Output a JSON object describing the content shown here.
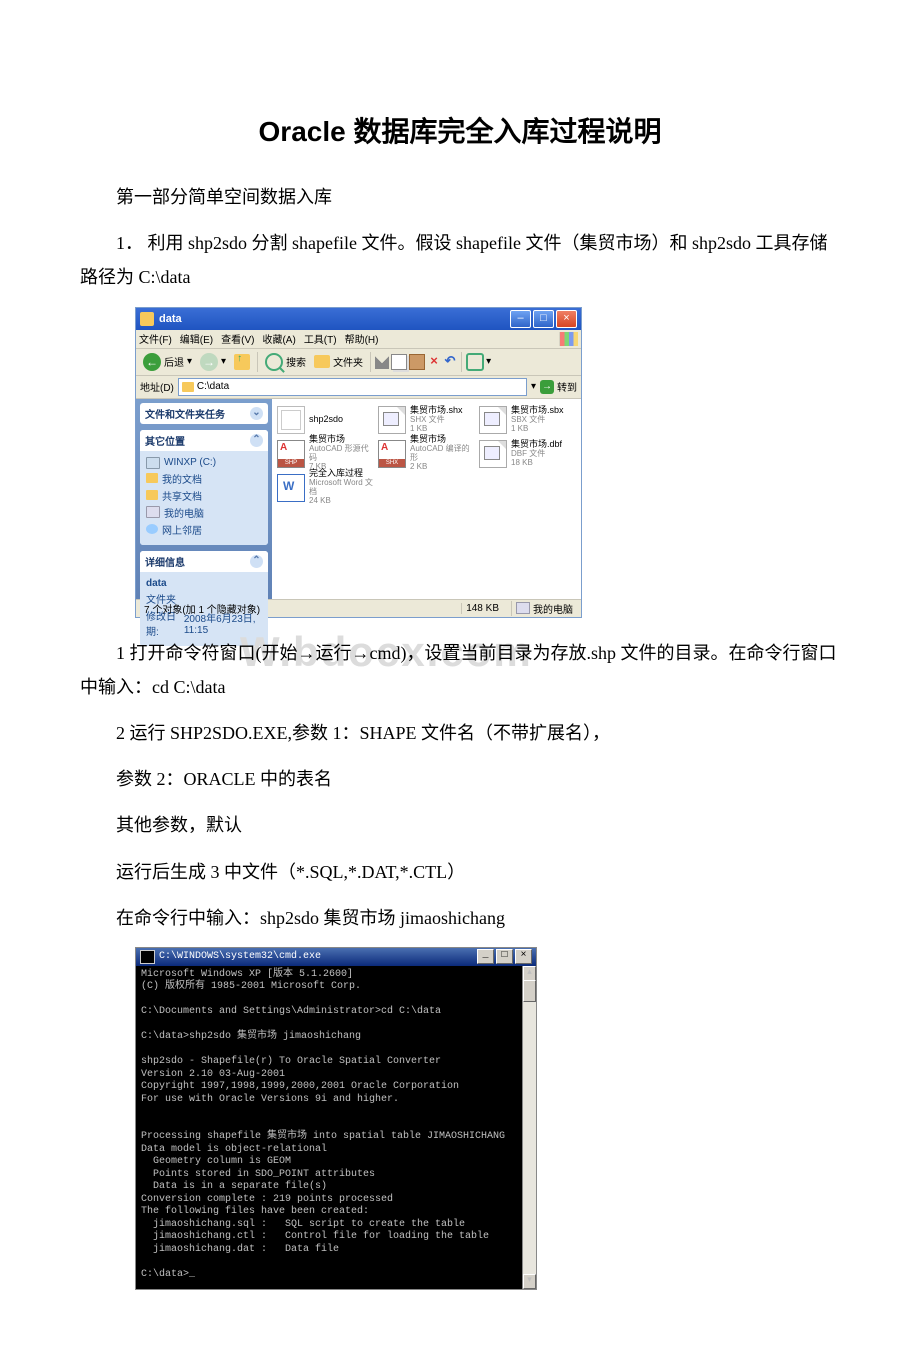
{
  "title": "Oracle 数据库完全入库过程说明",
  "p1": "第一部分简单空间数据入库",
  "p2": "1． 利用 shp2sdo 分割 shapefile 文件。假设 shapefile 文件（集贸市场）和 shp2sdo 工具存储路径为 C:\\data",
  "explorer": {
    "title": "data",
    "menu": {
      "file": "文件(F)",
      "edit": "编辑(E)",
      "view": "查看(V)",
      "fav": "收藏(A)",
      "tools": "工具(T)",
      "help": "帮助(H)"
    },
    "toolbar": {
      "back": "后退",
      "search": "搜索",
      "folders": "文件夹"
    },
    "address_label": "地址(D)",
    "address_value": "C:\\data",
    "go": "转到",
    "side": {
      "tasks_title": "文件和文件夹任务",
      "other_title": "其它位置",
      "other_items": [
        "WINXP (C:)",
        "我的文档",
        "共享文档",
        "我的电脑",
        "网上邻居"
      ],
      "details_title": "详细信息",
      "details_name": "data",
      "details_type": "文件夹",
      "details_mod_lbl": "修改日期:",
      "details_mod_val": "2008年6月23日, 11:15"
    },
    "files": [
      {
        "icon": "exe",
        "t1": "shp2sdo",
        "t2": ""
      },
      {
        "icon": "gen",
        "t1": "集贸市场.shx",
        "t2": "SHX 文件",
        "t3": "1 KB"
      },
      {
        "icon": "gen",
        "t1": "集贸市场.sbx",
        "t2": "SBX 文件",
        "t3": "1 KB"
      },
      {
        "icon": "shp",
        "t1": "集贸市场",
        "t2": "AutoCAD 形源代码",
        "t3": "7 KB",
        "lbl": "SHP"
      },
      {
        "icon": "shp",
        "t1": "集贸市场",
        "t2": "AutoCAD 编译的形",
        "t3": "2 KB",
        "lbl": "SHX"
      },
      {
        "icon": "gen",
        "t1": "集贸市场.dbf",
        "t2": "DBF 文件",
        "t3": "18 KB"
      },
      {
        "icon": "doc",
        "t1": "完全入库过程",
        "t2": "Microsoft Word 文档",
        "t3": "24 KB"
      }
    ],
    "status_left": "7 个对象(加 1 个隐藏对象)",
    "status_mid": "148 KB",
    "status_right": "我的电脑"
  },
  "p3": "1 打开命令符窗口(开始→运行→cmd)，设置当前目录为存放.shp 文件的目录。在命令行窗口中输入：cd C:\\data",
  "p4": "2 运行 SHP2SDO.EXE,参数 1：SHAPE 文件名（不带扩展名），",
  "p5": " 参数 2：ORACLE 中的表名",
  "p6": " 其他参数，默认",
  "p7": " 运行后生成 3 中文件（*.SQL,*.DAT,*.CTL）",
  "p8": " 在命令行中输入：shp2sdo 集贸市场 jimaoshichang",
  "watermark": "W.bdocx.com",
  "cmd": {
    "title": "C:\\WINDOWS\\system32\\cmd.exe",
    "lines": "Microsoft Windows XP [版本 5.1.2600]\n(C) 版权所有 1985-2001 Microsoft Corp.\n\nC:\\Documents and Settings\\Administrator>cd C:\\data\n\nC:\\data>shp2sdo 集贸市场 jimaoshichang\n\nshp2sdo - Shapefile(r) To Oracle Spatial Converter\nVersion 2.10 03-Aug-2001\nCopyright 1997,1998,1999,2000,2001 Oracle Corporation\nFor use with Oracle Versions 9i and higher.\n\n\nProcessing shapefile 集贸市场 into spatial table JIMAOSHICHANG\nData model is object-relational\n  Geometry column is GEOM\n  Points stored in SDO_POINT attributes\n  Data is in a separate file(s)\nConversion complete : 219 points processed\nThe following files have been created:\n  jimaoshichang.sql :   SQL script to create the table\n  jimaoshichang.ctl :   Control file for loading the table\n  jimaoshichang.dat :   Data file\n\nC:\\data>_"
  }
}
